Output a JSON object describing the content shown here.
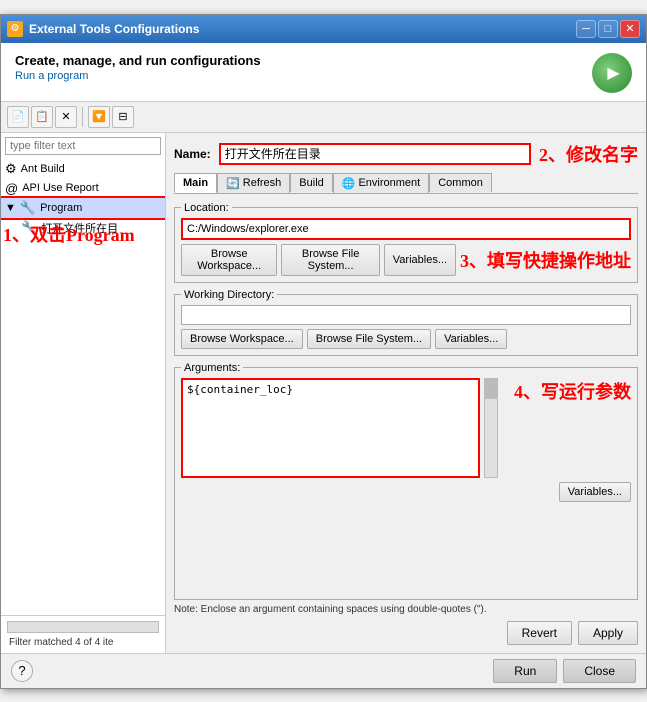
{
  "window": {
    "title": "External Tools Configurations",
    "icon": "⚙"
  },
  "header": {
    "title": "Create, manage, and run configurations",
    "subtitle": "Run a program"
  },
  "toolbar": {
    "buttons": [
      "new",
      "copy",
      "delete",
      "filter",
      "collapse",
      "expand"
    ]
  },
  "left_panel": {
    "filter_placeholder": "type filter text",
    "tree_items": [
      {
        "label": "Ant Build",
        "icon": "⚙",
        "level": 1
      },
      {
        "label": "API Use Report",
        "icon": "@",
        "level": 1
      },
      {
        "label": "Program",
        "icon": "🔧",
        "level": 1,
        "selected": true
      },
      {
        "label": "打开文件所在目",
        "icon": "🔧",
        "level": 2
      }
    ],
    "filter_status": "Filter matched 4 of 4 ite",
    "annotation": "1、双击Program"
  },
  "name_field": {
    "label": "Name:",
    "value": "打开文件所在目录",
    "annotation": "2、修改名字"
  },
  "tabs": [
    {
      "label": "Main",
      "active": true
    },
    {
      "label": "🔄 Refresh"
    },
    {
      "label": "Build"
    },
    {
      "label": "Environment"
    },
    {
      "label": "Common"
    }
  ],
  "location": {
    "legend": "Location:",
    "value": "C:/Windows/explorer.exe",
    "annotation": "3、填写快捷操作地址",
    "buttons": [
      "Browse Workspace...",
      "Browse File System...",
      "Variables..."
    ]
  },
  "working_dir": {
    "legend": "Working Directory:",
    "value": "",
    "buttons": [
      "Browse Workspace...",
      "Browse File System...",
      "Variables..."
    ]
  },
  "arguments": {
    "legend": "Arguments:",
    "value": "${container_loc}",
    "annotation": "4、写运行参数",
    "variables_btn": "Variables..."
  },
  "note": "Note: Enclose an argument containing spaces using double-quotes (\").",
  "bottom_buttons": {
    "revert": "Revert",
    "apply": "Apply"
  },
  "footer": {
    "run_btn": "Run",
    "close_btn": "Close"
  }
}
